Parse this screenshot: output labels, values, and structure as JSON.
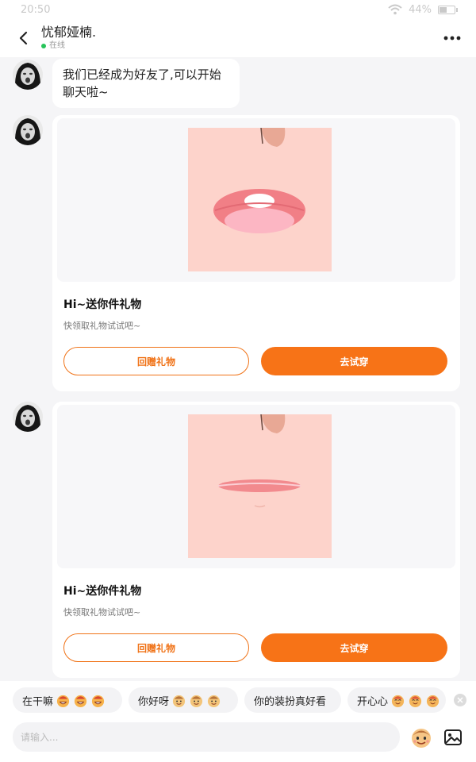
{
  "status_bar": {
    "time": "20:50",
    "battery": "44%",
    "wifi_icon": "wifi-icon",
    "battery_icon": "battery-icon"
  },
  "header": {
    "title": "忧郁娅楠.",
    "status": "在线",
    "back_icon": "chevron-left-icon",
    "more_icon": "more-horizontal-icon"
  },
  "messages": {
    "greeting": "我们已经成为好友了,可以开始聊天啦~",
    "gifts": [
      {
        "title": "Hi~送你件礼物",
        "subtitle": "快领取礼物试试吧~",
        "return_label": "回赠礼物",
        "try_label": "去试穿"
      },
      {
        "title": "Hi~送你件礼物",
        "subtitle": "快领取礼物试试吧~",
        "return_label": "回赠礼物",
        "try_label": "去试穿"
      }
    ]
  },
  "quick_replies": [
    {
      "text": "在干嘛"
    },
    {
      "text": "你好呀"
    },
    {
      "text": "你的装扮真好看"
    },
    {
      "text": "开心心"
    }
  ],
  "input": {
    "placeholder": "请输入...",
    "value": "",
    "emoji_icon": "emoji-face-icon",
    "image_icon": "image-icon"
  },
  "colors": {
    "accent": "#f77317",
    "online": "#27c45a",
    "background": "#f5f5f7"
  }
}
